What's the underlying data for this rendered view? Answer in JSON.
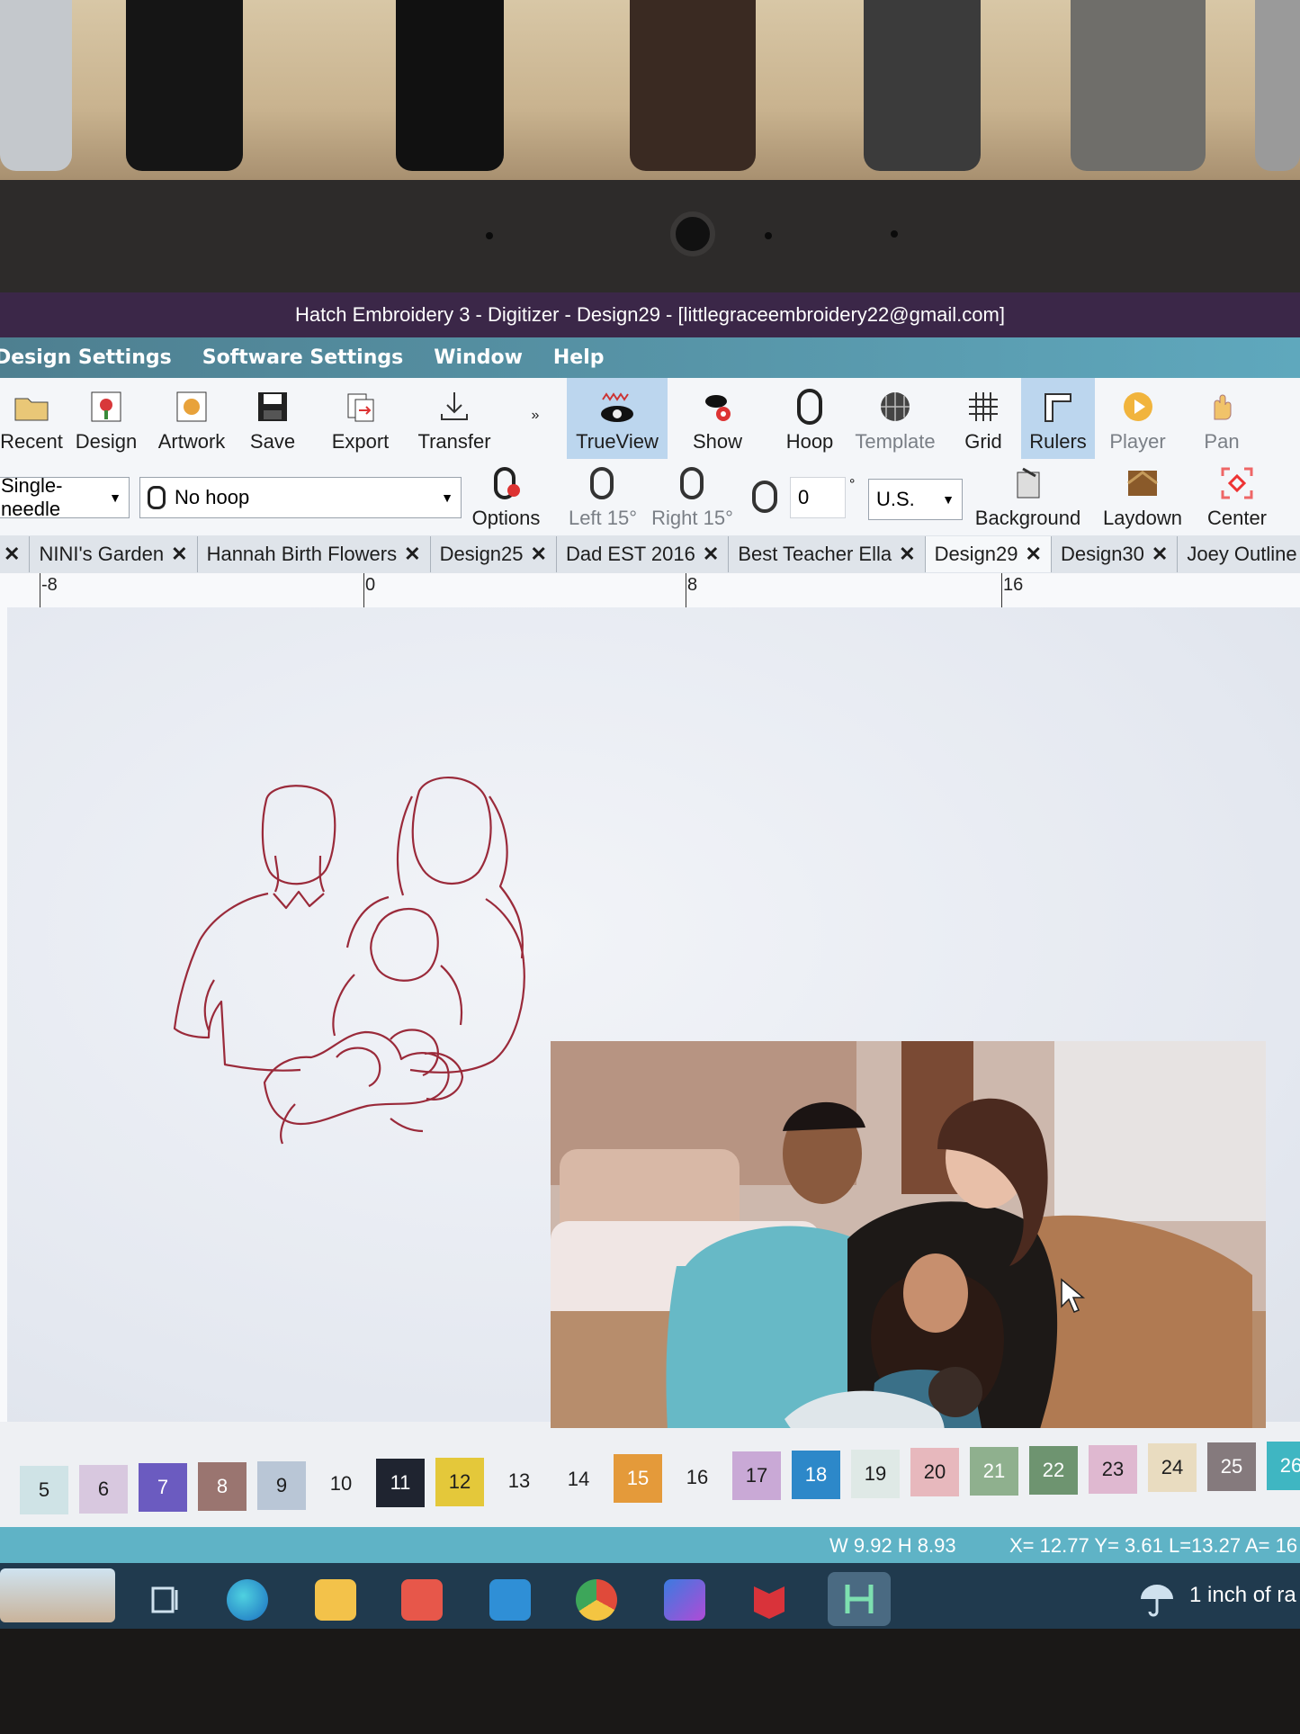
{
  "window": {
    "title": "Hatch Embroidery 3 - Digitizer - Design29 - [littlegraceembroidery22@gmail.com]"
  },
  "menu": [
    "Design Settings",
    "Software Settings",
    "Window",
    "Help"
  ],
  "toolbar": {
    "recent": "Recent",
    "design": "Design",
    "artwork": "Artwork",
    "save": "Save",
    "export": "Export",
    "transfer": "Transfer",
    "trueview": "TrueView",
    "show": "Show",
    "hoop": "Hoop",
    "template": "Template",
    "grid": "Grid",
    "rulers": "Rulers",
    "player": "Player",
    "pan": "Pan"
  },
  "toolbar2": {
    "machine_select": "Single-needle",
    "hoop_select": "No hoop",
    "options": "Options",
    "left": "Left 15°",
    "right": "Right 15°",
    "rotate_value": "0",
    "degree": "°",
    "units": "U.S.",
    "background": "Background",
    "laydown": "Laydown",
    "center": "Center"
  },
  "tabs": [
    {
      "label": "NINI's Garden"
    },
    {
      "label": "Hannah Birth Flowers"
    },
    {
      "label": "Design25"
    },
    {
      "label": "Dad EST 2016"
    },
    {
      "label": "Best Teacher Ella"
    },
    {
      "label": "Design29",
      "active": true
    },
    {
      "label": "Design30"
    },
    {
      "label": "Joey Outline"
    }
  ],
  "ruler": {
    "labels": [
      "-8",
      "0",
      "8",
      "16"
    ]
  },
  "palette": [
    {
      "n": "5",
      "color": "#cfe3e6"
    },
    {
      "n": "6",
      "color": "#d8c8df"
    },
    {
      "n": "7",
      "color": "#6b5bc0"
    },
    {
      "n": "8",
      "color": "#9a7570"
    },
    {
      "n": "9",
      "color": "#b9c6d6"
    },
    {
      "n": "10",
      "color": "#eef0f3"
    },
    {
      "n": "11",
      "color": "#1f2430"
    },
    {
      "n": "12",
      "color": "#e4c83a"
    },
    {
      "n": "13",
      "color": "#eef0f3"
    },
    {
      "n": "14",
      "color": "#eef0f3"
    },
    {
      "n": "15",
      "color": "#e49a3a"
    },
    {
      "n": "16",
      "color": "#eef0f3"
    },
    {
      "n": "17",
      "color": "#c9a9d6"
    },
    {
      "n": "18",
      "color": "#2d88c9"
    },
    {
      "n": "19",
      "color": "#dfe9e6"
    },
    {
      "n": "20",
      "color": "#e7b8bd"
    },
    {
      "n": "21",
      "color": "#8fb08e"
    },
    {
      "n": "22",
      "color": "#6e9470"
    },
    {
      "n": "23",
      "color": "#dfb8d0"
    },
    {
      "n": "24",
      "color": "#e9dcc0"
    },
    {
      "n": "25",
      "color": "#857a7d"
    },
    {
      "n": "26",
      "color": "#3fb6c2"
    }
  ],
  "status": {
    "size": "W 9.92 H 8.93",
    "coords": "X= 12.77 Y= 3.61 L=13.27 A= 16"
  },
  "taskbar": {
    "weather": "1 inch of ra"
  }
}
